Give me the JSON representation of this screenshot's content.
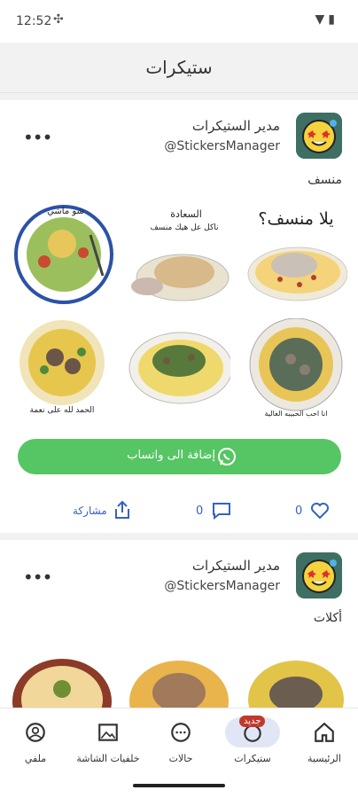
{
  "status_bar": {
    "time": "12:52"
  },
  "app_bar": {
    "title": "ستيكرات"
  },
  "posts": [
    {
      "author": "مدير الستيكرات",
      "handle": "@StickersManager",
      "pack_name": "منسف",
      "stickers": [
        {
          "caption": "يلا منسف؟"
        },
        {
          "caption": "السعادة",
          "sub": "ناكل عل هيك منسف"
        },
        {
          "caption": "شو ماشي"
        },
        {
          "caption": "انا احب الحبيبه الغالية"
        },
        {
          "caption": ""
        },
        {
          "caption": "الحمد لله على نعمة"
        }
      ],
      "add_button": "إضافة الى واتساب",
      "likes": "0",
      "comments": "0",
      "share": "مشاركة"
    },
    {
      "author": "مدير الستيكرات",
      "handle": "@StickersManager",
      "pack_name": "أكلات"
    }
  ],
  "bottom_nav": {
    "items": [
      {
        "label": "الرئيسية",
        "icon": "home-icon"
      },
      {
        "label": "ستيكرات",
        "icon": "sticker-icon",
        "badge": "جديد"
      },
      {
        "label": "حالات",
        "icon": "status-icon"
      },
      {
        "label": "خلفيات الشاشة",
        "icon": "wallpaper-icon"
      },
      {
        "label": "ملفي",
        "icon": "profile-icon"
      }
    ]
  },
  "colors": {
    "accent": "#56c563",
    "link": "#3462c4",
    "badge": "#c0392b"
  }
}
